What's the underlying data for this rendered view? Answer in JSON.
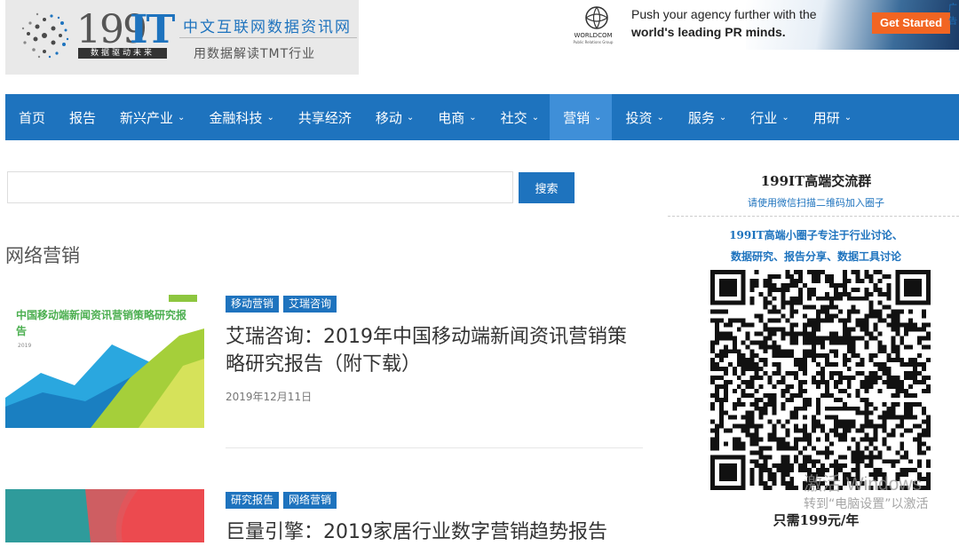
{
  "logo": {
    "num": "199",
    "it": "IT",
    "slogan": "数据驱动未来",
    "cn_title": "中文互联网数据资讯网",
    "cn_sub": "用数据解读TMT行业"
  },
  "ad": {
    "brand": "WORLDCOM",
    "brand_sub": "Public Relations Group",
    "line1": "Push your agency further with the",
    "line2": "world's leading PR minds.",
    "cta": "Get Started",
    "tag": "广告"
  },
  "nav": [
    {
      "label": "首页",
      "has_menu": false
    },
    {
      "label": "报告",
      "has_menu": false
    },
    {
      "label": "新兴产业",
      "has_menu": true
    },
    {
      "label": "金融科技",
      "has_menu": true
    },
    {
      "label": "共享经济",
      "has_menu": false
    },
    {
      "label": "移动",
      "has_menu": true
    },
    {
      "label": "电商",
      "has_menu": true
    },
    {
      "label": "社交",
      "has_menu": true
    },
    {
      "label": "营销",
      "has_menu": true,
      "active": true
    },
    {
      "label": "投资",
      "has_menu": true
    },
    {
      "label": "服务",
      "has_menu": true
    },
    {
      "label": "行业",
      "has_menu": true
    },
    {
      "label": "用研",
      "has_menu": true
    }
  ],
  "search": {
    "value": "",
    "button": "搜索"
  },
  "section_title": "网络营销",
  "articles": [
    {
      "tags": [
        "移动营销",
        "艾瑞咨询"
      ],
      "title": "艾瑞咨询：2019年中国移动端新闻资讯营销策略研究报告（附下载）",
      "date": "2019年12月11日",
      "thumb_title": "中国移动端新闻资讯营销策略研究报告",
      "thumb_year": "2019"
    },
    {
      "tags": [
        "研究报告",
        "网络营销"
      ],
      "title": "巨量引擎：2019家居行业数字营销趋势报告",
      "date": ""
    }
  ],
  "sidebar": {
    "title": "199IT高端交流群",
    "subtitle": "请使用微信扫描二维码加入圈子",
    "desc1": "199IT高端小圈子专注于行业讨论、",
    "desc2": "数据研究、报告分享、数据工具讨论",
    "price": "只需199元/年"
  },
  "watermark": {
    "line1": "激活 Windows",
    "line2": "转到“电脑设置”以激活"
  },
  "colors": {
    "brand_blue": "#1e73be",
    "nav_active": "#3f8fd8",
    "ad_cta": "#f26522"
  }
}
